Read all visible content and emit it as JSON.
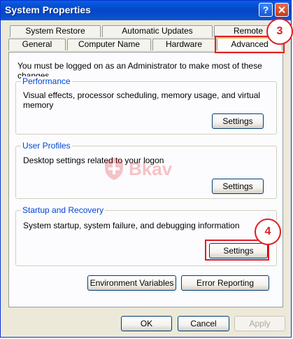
{
  "window": {
    "title": "System Properties",
    "help_label": "?",
    "close_icon": "close-icon"
  },
  "tabs": {
    "row_back": [
      "System Restore",
      "Automatic Updates",
      "Remote"
    ],
    "row_front": [
      "General",
      "Computer Name",
      "Hardware",
      "Advanced"
    ],
    "active": "Advanced"
  },
  "advanced": {
    "admin_notice": "You must be logged on as an Administrator to make most of these changes.",
    "performance": {
      "title": "Performance",
      "description": "Visual effects, processor scheduling, memory usage, and virtual memory",
      "settings_label": "Settings"
    },
    "user_profiles": {
      "title": "User Profiles",
      "description": "Desktop settings related to your logon",
      "settings_label": "Settings"
    },
    "startup_recovery": {
      "title": "Startup and Recovery",
      "description": "System startup, system failure, and debugging information",
      "settings_label": "Settings"
    },
    "env_vars_label": "Environment Variables",
    "error_reporting_label": "Error Reporting"
  },
  "footer": {
    "ok_label": "OK",
    "cancel_label": "Cancel",
    "apply_label": "Apply"
  },
  "annotations": {
    "step3": "3",
    "step4": "4",
    "highlight_color": "#E11B22"
  },
  "watermark": {
    "text": "Bkav",
    "icon": "shield-icon"
  }
}
